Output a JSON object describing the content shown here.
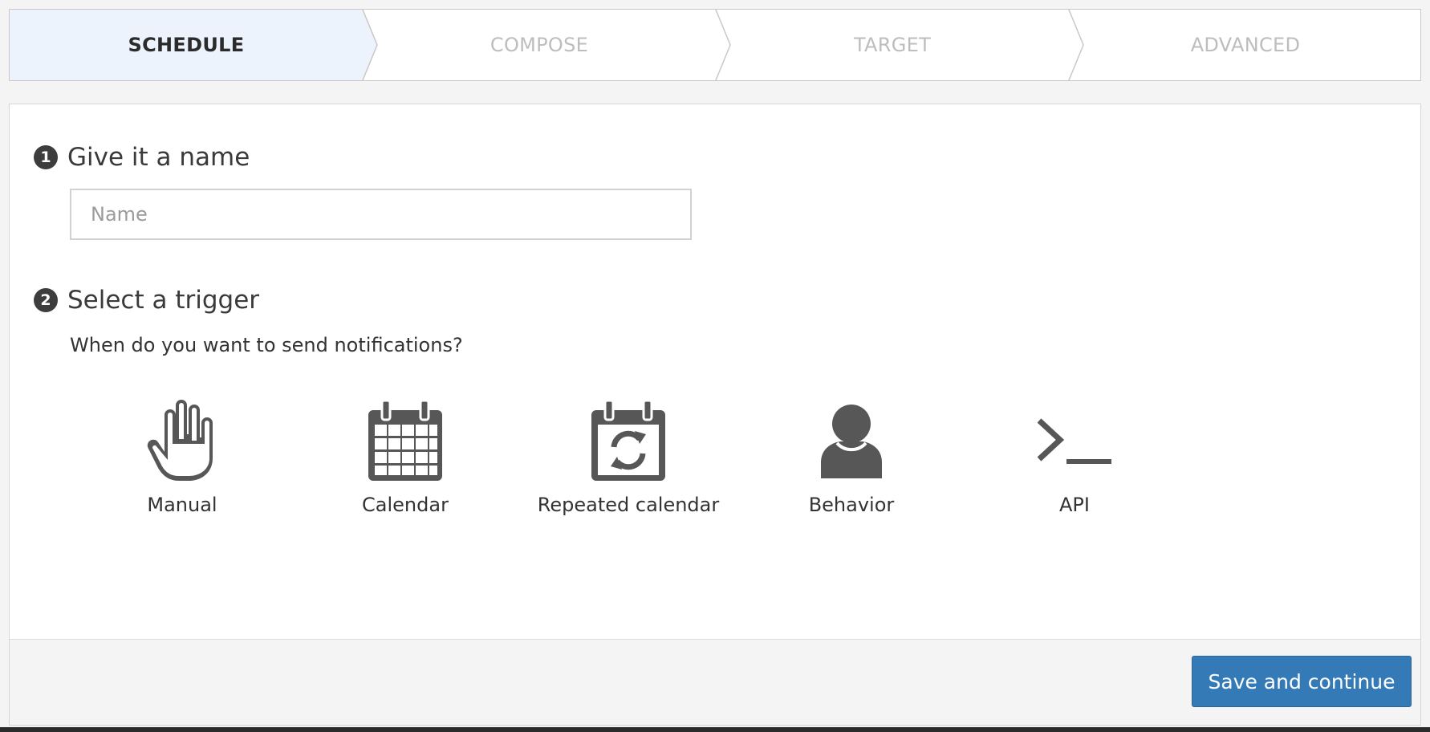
{
  "wizard": {
    "steps": [
      {
        "label": "SCHEDULE",
        "active": true
      },
      {
        "label": "COMPOSE",
        "active": false
      },
      {
        "label": "TARGET",
        "active": false
      },
      {
        "label": "ADVANCED",
        "active": false
      }
    ]
  },
  "section1": {
    "number": "1",
    "title": "Give it a name",
    "name_placeholder": "Name",
    "name_value": ""
  },
  "section2": {
    "number": "2",
    "title": "Select a trigger",
    "question": "When do you want to send notifications?",
    "triggers": [
      {
        "label": "Manual",
        "icon": "hand-icon"
      },
      {
        "label": "Calendar",
        "icon": "calendar-icon"
      },
      {
        "label": "Repeated calendar",
        "icon": "repeated-calendar-icon"
      },
      {
        "label": "Behavior",
        "icon": "user-icon"
      },
      {
        "label": "API",
        "icon": "terminal-icon"
      }
    ]
  },
  "footer": {
    "save_label": "Save and continue"
  },
  "colors": {
    "active_step_bg": "#edf3fc",
    "icon_gray": "#575757",
    "primary_button": "#337ab7"
  }
}
